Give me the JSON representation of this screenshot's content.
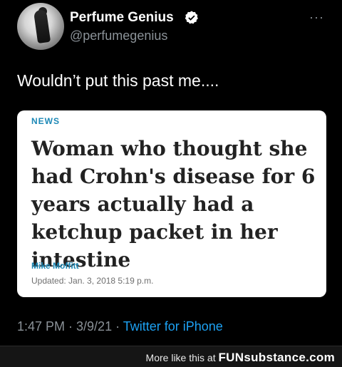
{
  "tweet": {
    "display_name": "Perfume Genius",
    "handle": "@perfumegenius",
    "more_icon": "more-horizontal-icon",
    "text": "Wouldn’t put this past me....",
    "card": {
      "category": "NEWS",
      "headline": "Woman who thought she had Crohn's disease for 6 years actually had a ketchup packet in her intestine",
      "author": "Mike Moffitt",
      "updated": "Updated: Jan. 3, 2018 5:19 p.m."
    },
    "time": "1:47 PM · 3/9/21 · ",
    "source": "Twitter for iPhone"
  },
  "footer": {
    "prefix": "More like this at ",
    "brand": "FUNsubstance.com"
  },
  "colors": {
    "background": "#000000",
    "verified": "#ffffff",
    "link": "#1da1f2",
    "card_accent": "#1c88b6"
  }
}
